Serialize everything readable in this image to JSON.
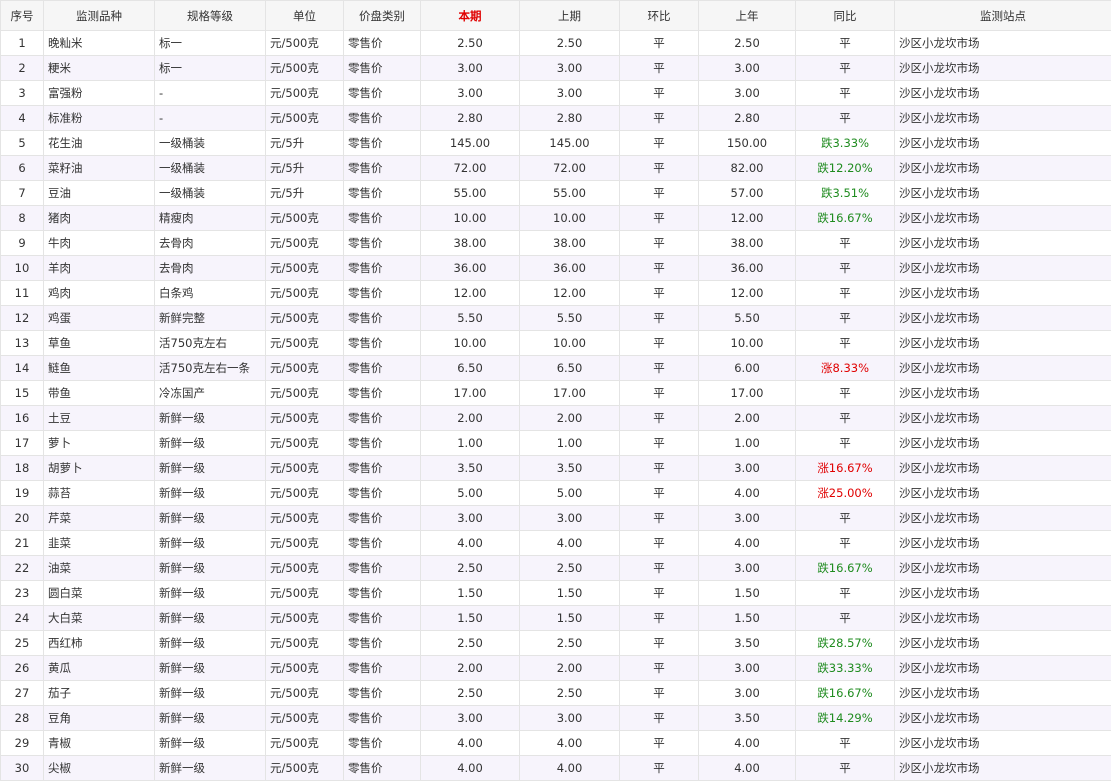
{
  "headers": [
    "序号",
    "监测品种",
    "规格等级",
    "单位",
    "价盘类别",
    "本期",
    "上期",
    "环比",
    "上年",
    "同比",
    "监测站点"
  ],
  "rows": [
    [
      "1",
      "晚籼米",
      "标一",
      "元/500克",
      "零售价",
      "2.50",
      "2.50",
      "平",
      "2.50",
      "平",
      "沙区小龙坎市场"
    ],
    [
      "2",
      "粳米",
      "标一",
      "元/500克",
      "零售价",
      "3.00",
      "3.00",
      "平",
      "3.00",
      "平",
      "沙区小龙坎市场"
    ],
    [
      "3",
      "富强粉",
      "-",
      "元/500克",
      "零售价",
      "3.00",
      "3.00",
      "平",
      "3.00",
      "平",
      "沙区小龙坎市场"
    ],
    [
      "4",
      "标准粉",
      "-",
      "元/500克",
      "零售价",
      "2.80",
      "2.80",
      "平",
      "2.80",
      "平",
      "沙区小龙坎市场"
    ],
    [
      "5",
      "花生油",
      "一级桶装",
      "元/5升",
      "零售价",
      "145.00",
      "145.00",
      "平",
      "150.00",
      "跌3.33%",
      "沙区小龙坎市场"
    ],
    [
      "6",
      "菜籽油",
      "一级桶装",
      "元/5升",
      "零售价",
      "72.00",
      "72.00",
      "平",
      "82.00",
      "跌12.20%",
      "沙区小龙坎市场"
    ],
    [
      "7",
      "豆油",
      "一级桶装",
      "元/5升",
      "零售价",
      "55.00",
      "55.00",
      "平",
      "57.00",
      "跌3.51%",
      "沙区小龙坎市场"
    ],
    [
      "8",
      "猪肉",
      "精瘦肉",
      "元/500克",
      "零售价",
      "10.00",
      "10.00",
      "平",
      "12.00",
      "跌16.67%",
      "沙区小龙坎市场"
    ],
    [
      "9",
      "牛肉",
      "去骨肉",
      "元/500克",
      "零售价",
      "38.00",
      "38.00",
      "平",
      "38.00",
      "平",
      "沙区小龙坎市场"
    ],
    [
      "10",
      "羊肉",
      "去骨肉",
      "元/500克",
      "零售价",
      "36.00",
      "36.00",
      "平",
      "36.00",
      "平",
      "沙区小龙坎市场"
    ],
    [
      "11",
      "鸡肉",
      "白条鸡",
      "元/500克",
      "零售价",
      "12.00",
      "12.00",
      "平",
      "12.00",
      "平",
      "沙区小龙坎市场"
    ],
    [
      "12",
      "鸡蛋",
      "新鲜完整",
      "元/500克",
      "零售价",
      "5.50",
      "5.50",
      "平",
      "5.50",
      "平",
      "沙区小龙坎市场"
    ],
    [
      "13",
      "草鱼",
      "活750克左右",
      "元/500克",
      "零售价",
      "10.00",
      "10.00",
      "平",
      "10.00",
      "平",
      "沙区小龙坎市场"
    ],
    [
      "14",
      "鲢鱼",
      "活750克左右一条",
      "元/500克",
      "零售价",
      "6.50",
      "6.50",
      "平",
      "6.00",
      "涨8.33%",
      "沙区小龙坎市场"
    ],
    [
      "15",
      "带鱼",
      "冷冻国产",
      "元/500克",
      "零售价",
      "17.00",
      "17.00",
      "平",
      "17.00",
      "平",
      "沙区小龙坎市场"
    ],
    [
      "16",
      "土豆",
      "新鲜一级",
      "元/500克",
      "零售价",
      "2.00",
      "2.00",
      "平",
      "2.00",
      "平",
      "沙区小龙坎市场"
    ],
    [
      "17",
      "萝卜",
      "新鲜一级",
      "元/500克",
      "零售价",
      "1.00",
      "1.00",
      "平",
      "1.00",
      "平",
      "沙区小龙坎市场"
    ],
    [
      "18",
      "胡萝卜",
      "新鲜一级",
      "元/500克",
      "零售价",
      "3.50",
      "3.50",
      "平",
      "3.00",
      "涨16.67%",
      "沙区小龙坎市场"
    ],
    [
      "19",
      "蒜苔",
      "新鲜一级",
      "元/500克",
      "零售价",
      "5.00",
      "5.00",
      "平",
      "4.00",
      "涨25.00%",
      "沙区小龙坎市场"
    ],
    [
      "20",
      "芹菜",
      "新鲜一级",
      "元/500克",
      "零售价",
      "3.00",
      "3.00",
      "平",
      "3.00",
      "平",
      "沙区小龙坎市场"
    ],
    [
      "21",
      "韭菜",
      "新鲜一级",
      "元/500克",
      "零售价",
      "4.00",
      "4.00",
      "平",
      "4.00",
      "平",
      "沙区小龙坎市场"
    ],
    [
      "22",
      "油菜",
      "新鲜一级",
      "元/500克",
      "零售价",
      "2.50",
      "2.50",
      "平",
      "3.00",
      "跌16.67%",
      "沙区小龙坎市场"
    ],
    [
      "23",
      "圆白菜",
      "新鲜一级",
      "元/500克",
      "零售价",
      "1.50",
      "1.50",
      "平",
      "1.50",
      "平",
      "沙区小龙坎市场"
    ],
    [
      "24",
      "大白菜",
      "新鲜一级",
      "元/500克",
      "零售价",
      "1.50",
      "1.50",
      "平",
      "1.50",
      "平",
      "沙区小龙坎市场"
    ],
    [
      "25",
      "西红柿",
      "新鲜一级",
      "元/500克",
      "零售价",
      "2.50",
      "2.50",
      "平",
      "3.50",
      "跌28.57%",
      "沙区小龙坎市场"
    ],
    [
      "26",
      "黄瓜",
      "新鲜一级",
      "元/500克",
      "零售价",
      "2.00",
      "2.00",
      "平",
      "3.00",
      "跌33.33%",
      "沙区小龙坎市场"
    ],
    [
      "27",
      "茄子",
      "新鲜一级",
      "元/500克",
      "零售价",
      "2.50",
      "2.50",
      "平",
      "3.00",
      "跌16.67%",
      "沙区小龙坎市场"
    ],
    [
      "28",
      "豆角",
      "新鲜一级",
      "元/500克",
      "零售价",
      "3.00",
      "3.00",
      "平",
      "3.50",
      "跌14.29%",
      "沙区小龙坎市场"
    ],
    [
      "29",
      "青椒",
      "新鲜一级",
      "元/500克",
      "零售价",
      "4.00",
      "4.00",
      "平",
      "4.00",
      "平",
      "沙区小龙坎市场"
    ],
    [
      "30",
      "尖椒",
      "新鲜一级",
      "元/500克",
      "零售价",
      "4.00",
      "4.00",
      "平",
      "4.00",
      "平",
      "沙区小龙坎市场"
    ]
  ],
  "colors": {
    "up": "#e00000",
    "down": "#1e8b1e",
    "highlight_header": "#e00000"
  }
}
